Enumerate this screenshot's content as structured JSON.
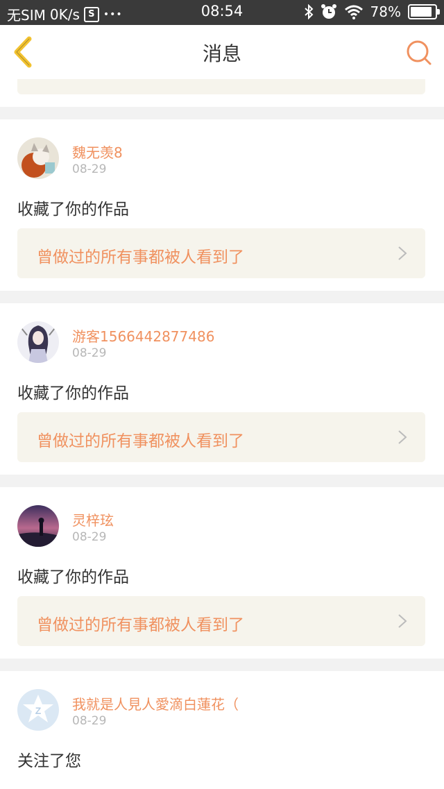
{
  "status_bar": {
    "carrier": "无SIM",
    "speed": "0K/s",
    "s_icon": "S",
    "dots": "•••",
    "time": "08:54",
    "battery": "78%"
  },
  "nav": {
    "title": "消息"
  },
  "messages": [
    {
      "user": "魏无羡8",
      "date": "08-29",
      "action": "收藏了你的作品",
      "work": "曾做过的所有事都被人看到了",
      "avatar_color": "#d9a67c"
    },
    {
      "user": "游客1566442877486",
      "date": "08-29",
      "action": "收藏了你的作品",
      "work": "曾做过的所有事都被人看到了",
      "avatar_color": "#9aa0b8"
    },
    {
      "user": "灵梓玹",
      "date": "08-29",
      "action": "收藏了你的作品",
      "work": "曾做过的所有事都被人看到了",
      "avatar_color": "#5c4a7a"
    },
    {
      "user": "我就是人見人愛滴白蓮花（",
      "date": "08-29",
      "action": "关注了您",
      "avatar_color": "#dbe8f4"
    }
  ],
  "colors": {
    "accent": "#f0915f",
    "back_icon": "#f2c230",
    "link_bg": "#f6f4ec"
  }
}
